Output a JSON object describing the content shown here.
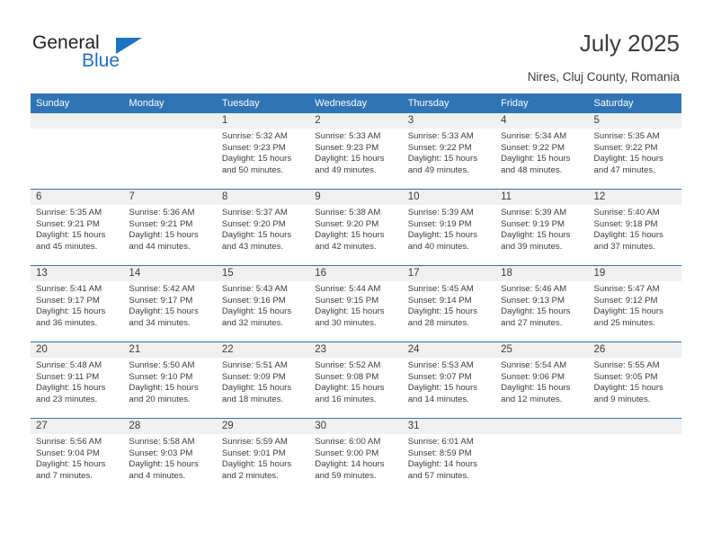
{
  "brand": {
    "name_top": "General",
    "name_bottom": "Blue",
    "accent_color": "#1c72c4"
  },
  "header": {
    "title": "July 2025",
    "location": "Nires, Cluj County, Romania"
  },
  "calendar": {
    "header_bg": "#2f74b5",
    "daynum_bg": "#f0f0f0",
    "weekday_headers": [
      "Sunday",
      "Monday",
      "Tuesday",
      "Wednesday",
      "Thursday",
      "Friday",
      "Saturday"
    ],
    "labels": {
      "sunrise": "Sunrise:",
      "sunset": "Sunset:",
      "daylight": "Daylight:"
    },
    "weeks": [
      [
        {
          "day": "",
          "sunrise": "",
          "sunset": "",
          "daylight_line1": "",
          "daylight_line2": ""
        },
        {
          "day": "",
          "sunrise": "",
          "sunset": "",
          "daylight_line1": "",
          "daylight_line2": ""
        },
        {
          "day": "1",
          "sunrise": "Sunrise: 5:32 AM",
          "sunset": "Sunset: 9:23 PM",
          "daylight_line1": "Daylight: 15 hours",
          "daylight_line2": "and 50 minutes."
        },
        {
          "day": "2",
          "sunrise": "Sunrise: 5:33 AM",
          "sunset": "Sunset: 9:23 PM",
          "daylight_line1": "Daylight: 15 hours",
          "daylight_line2": "and 49 minutes."
        },
        {
          "day": "3",
          "sunrise": "Sunrise: 5:33 AM",
          "sunset": "Sunset: 9:22 PM",
          "daylight_line1": "Daylight: 15 hours",
          "daylight_line2": "and 49 minutes."
        },
        {
          "day": "4",
          "sunrise": "Sunrise: 5:34 AM",
          "sunset": "Sunset: 9:22 PM",
          "daylight_line1": "Daylight: 15 hours",
          "daylight_line2": "and 48 minutes."
        },
        {
          "day": "5",
          "sunrise": "Sunrise: 5:35 AM",
          "sunset": "Sunset: 9:22 PM",
          "daylight_line1": "Daylight: 15 hours",
          "daylight_line2": "and 47 minutes."
        }
      ],
      [
        {
          "day": "6",
          "sunrise": "Sunrise: 5:35 AM",
          "sunset": "Sunset: 9:21 PM",
          "daylight_line1": "Daylight: 15 hours",
          "daylight_line2": "and 45 minutes."
        },
        {
          "day": "7",
          "sunrise": "Sunrise: 5:36 AM",
          "sunset": "Sunset: 9:21 PM",
          "daylight_line1": "Daylight: 15 hours",
          "daylight_line2": "and 44 minutes."
        },
        {
          "day": "8",
          "sunrise": "Sunrise: 5:37 AM",
          "sunset": "Sunset: 9:20 PM",
          "daylight_line1": "Daylight: 15 hours",
          "daylight_line2": "and 43 minutes."
        },
        {
          "day": "9",
          "sunrise": "Sunrise: 5:38 AM",
          "sunset": "Sunset: 9:20 PM",
          "daylight_line1": "Daylight: 15 hours",
          "daylight_line2": "and 42 minutes."
        },
        {
          "day": "10",
          "sunrise": "Sunrise: 5:39 AM",
          "sunset": "Sunset: 9:19 PM",
          "daylight_line1": "Daylight: 15 hours",
          "daylight_line2": "and 40 minutes."
        },
        {
          "day": "11",
          "sunrise": "Sunrise: 5:39 AM",
          "sunset": "Sunset: 9:19 PM",
          "daylight_line1": "Daylight: 15 hours",
          "daylight_line2": "and 39 minutes."
        },
        {
          "day": "12",
          "sunrise": "Sunrise: 5:40 AM",
          "sunset": "Sunset: 9:18 PM",
          "daylight_line1": "Daylight: 15 hours",
          "daylight_line2": "and 37 minutes."
        }
      ],
      [
        {
          "day": "13",
          "sunrise": "Sunrise: 5:41 AM",
          "sunset": "Sunset: 9:17 PM",
          "daylight_line1": "Daylight: 15 hours",
          "daylight_line2": "and 36 minutes."
        },
        {
          "day": "14",
          "sunrise": "Sunrise: 5:42 AM",
          "sunset": "Sunset: 9:17 PM",
          "daylight_line1": "Daylight: 15 hours",
          "daylight_line2": "and 34 minutes."
        },
        {
          "day": "15",
          "sunrise": "Sunrise: 5:43 AM",
          "sunset": "Sunset: 9:16 PM",
          "daylight_line1": "Daylight: 15 hours",
          "daylight_line2": "and 32 minutes."
        },
        {
          "day": "16",
          "sunrise": "Sunrise: 5:44 AM",
          "sunset": "Sunset: 9:15 PM",
          "daylight_line1": "Daylight: 15 hours",
          "daylight_line2": "and 30 minutes."
        },
        {
          "day": "17",
          "sunrise": "Sunrise: 5:45 AM",
          "sunset": "Sunset: 9:14 PM",
          "daylight_line1": "Daylight: 15 hours",
          "daylight_line2": "and 28 minutes."
        },
        {
          "day": "18",
          "sunrise": "Sunrise: 5:46 AM",
          "sunset": "Sunset: 9:13 PM",
          "daylight_line1": "Daylight: 15 hours",
          "daylight_line2": "and 27 minutes."
        },
        {
          "day": "19",
          "sunrise": "Sunrise: 5:47 AM",
          "sunset": "Sunset: 9:12 PM",
          "daylight_line1": "Daylight: 15 hours",
          "daylight_line2": "and 25 minutes."
        }
      ],
      [
        {
          "day": "20",
          "sunrise": "Sunrise: 5:48 AM",
          "sunset": "Sunset: 9:11 PM",
          "daylight_line1": "Daylight: 15 hours",
          "daylight_line2": "and 23 minutes."
        },
        {
          "day": "21",
          "sunrise": "Sunrise: 5:50 AM",
          "sunset": "Sunset: 9:10 PM",
          "daylight_line1": "Daylight: 15 hours",
          "daylight_line2": "and 20 minutes."
        },
        {
          "day": "22",
          "sunrise": "Sunrise: 5:51 AM",
          "sunset": "Sunset: 9:09 PM",
          "daylight_line1": "Daylight: 15 hours",
          "daylight_line2": "and 18 minutes."
        },
        {
          "day": "23",
          "sunrise": "Sunrise: 5:52 AM",
          "sunset": "Sunset: 9:08 PM",
          "daylight_line1": "Daylight: 15 hours",
          "daylight_line2": "and 16 minutes."
        },
        {
          "day": "24",
          "sunrise": "Sunrise: 5:53 AM",
          "sunset": "Sunset: 9:07 PM",
          "daylight_line1": "Daylight: 15 hours",
          "daylight_line2": "and 14 minutes."
        },
        {
          "day": "25",
          "sunrise": "Sunrise: 5:54 AM",
          "sunset": "Sunset: 9:06 PM",
          "daylight_line1": "Daylight: 15 hours",
          "daylight_line2": "and 12 minutes."
        },
        {
          "day": "26",
          "sunrise": "Sunrise: 5:55 AM",
          "sunset": "Sunset: 9:05 PM",
          "daylight_line1": "Daylight: 15 hours",
          "daylight_line2": "and 9 minutes."
        }
      ],
      [
        {
          "day": "27",
          "sunrise": "Sunrise: 5:56 AM",
          "sunset": "Sunset: 9:04 PM",
          "daylight_line1": "Daylight: 15 hours",
          "daylight_line2": "and 7 minutes."
        },
        {
          "day": "28",
          "sunrise": "Sunrise: 5:58 AM",
          "sunset": "Sunset: 9:03 PM",
          "daylight_line1": "Daylight: 15 hours",
          "daylight_line2": "and 4 minutes."
        },
        {
          "day": "29",
          "sunrise": "Sunrise: 5:59 AM",
          "sunset": "Sunset: 9:01 PM",
          "daylight_line1": "Daylight: 15 hours",
          "daylight_line2": "and 2 minutes."
        },
        {
          "day": "30",
          "sunrise": "Sunrise: 6:00 AM",
          "sunset": "Sunset: 9:00 PM",
          "daylight_line1": "Daylight: 14 hours",
          "daylight_line2": "and 59 minutes."
        },
        {
          "day": "31",
          "sunrise": "Sunrise: 6:01 AM",
          "sunset": "Sunset: 8:59 PM",
          "daylight_line1": "Daylight: 14 hours",
          "daylight_line2": "and 57 minutes."
        },
        {
          "day": "",
          "sunrise": "",
          "sunset": "",
          "daylight_line1": "",
          "daylight_line2": ""
        },
        {
          "day": "",
          "sunrise": "",
          "sunset": "",
          "daylight_line1": "",
          "daylight_line2": ""
        }
      ]
    ]
  }
}
